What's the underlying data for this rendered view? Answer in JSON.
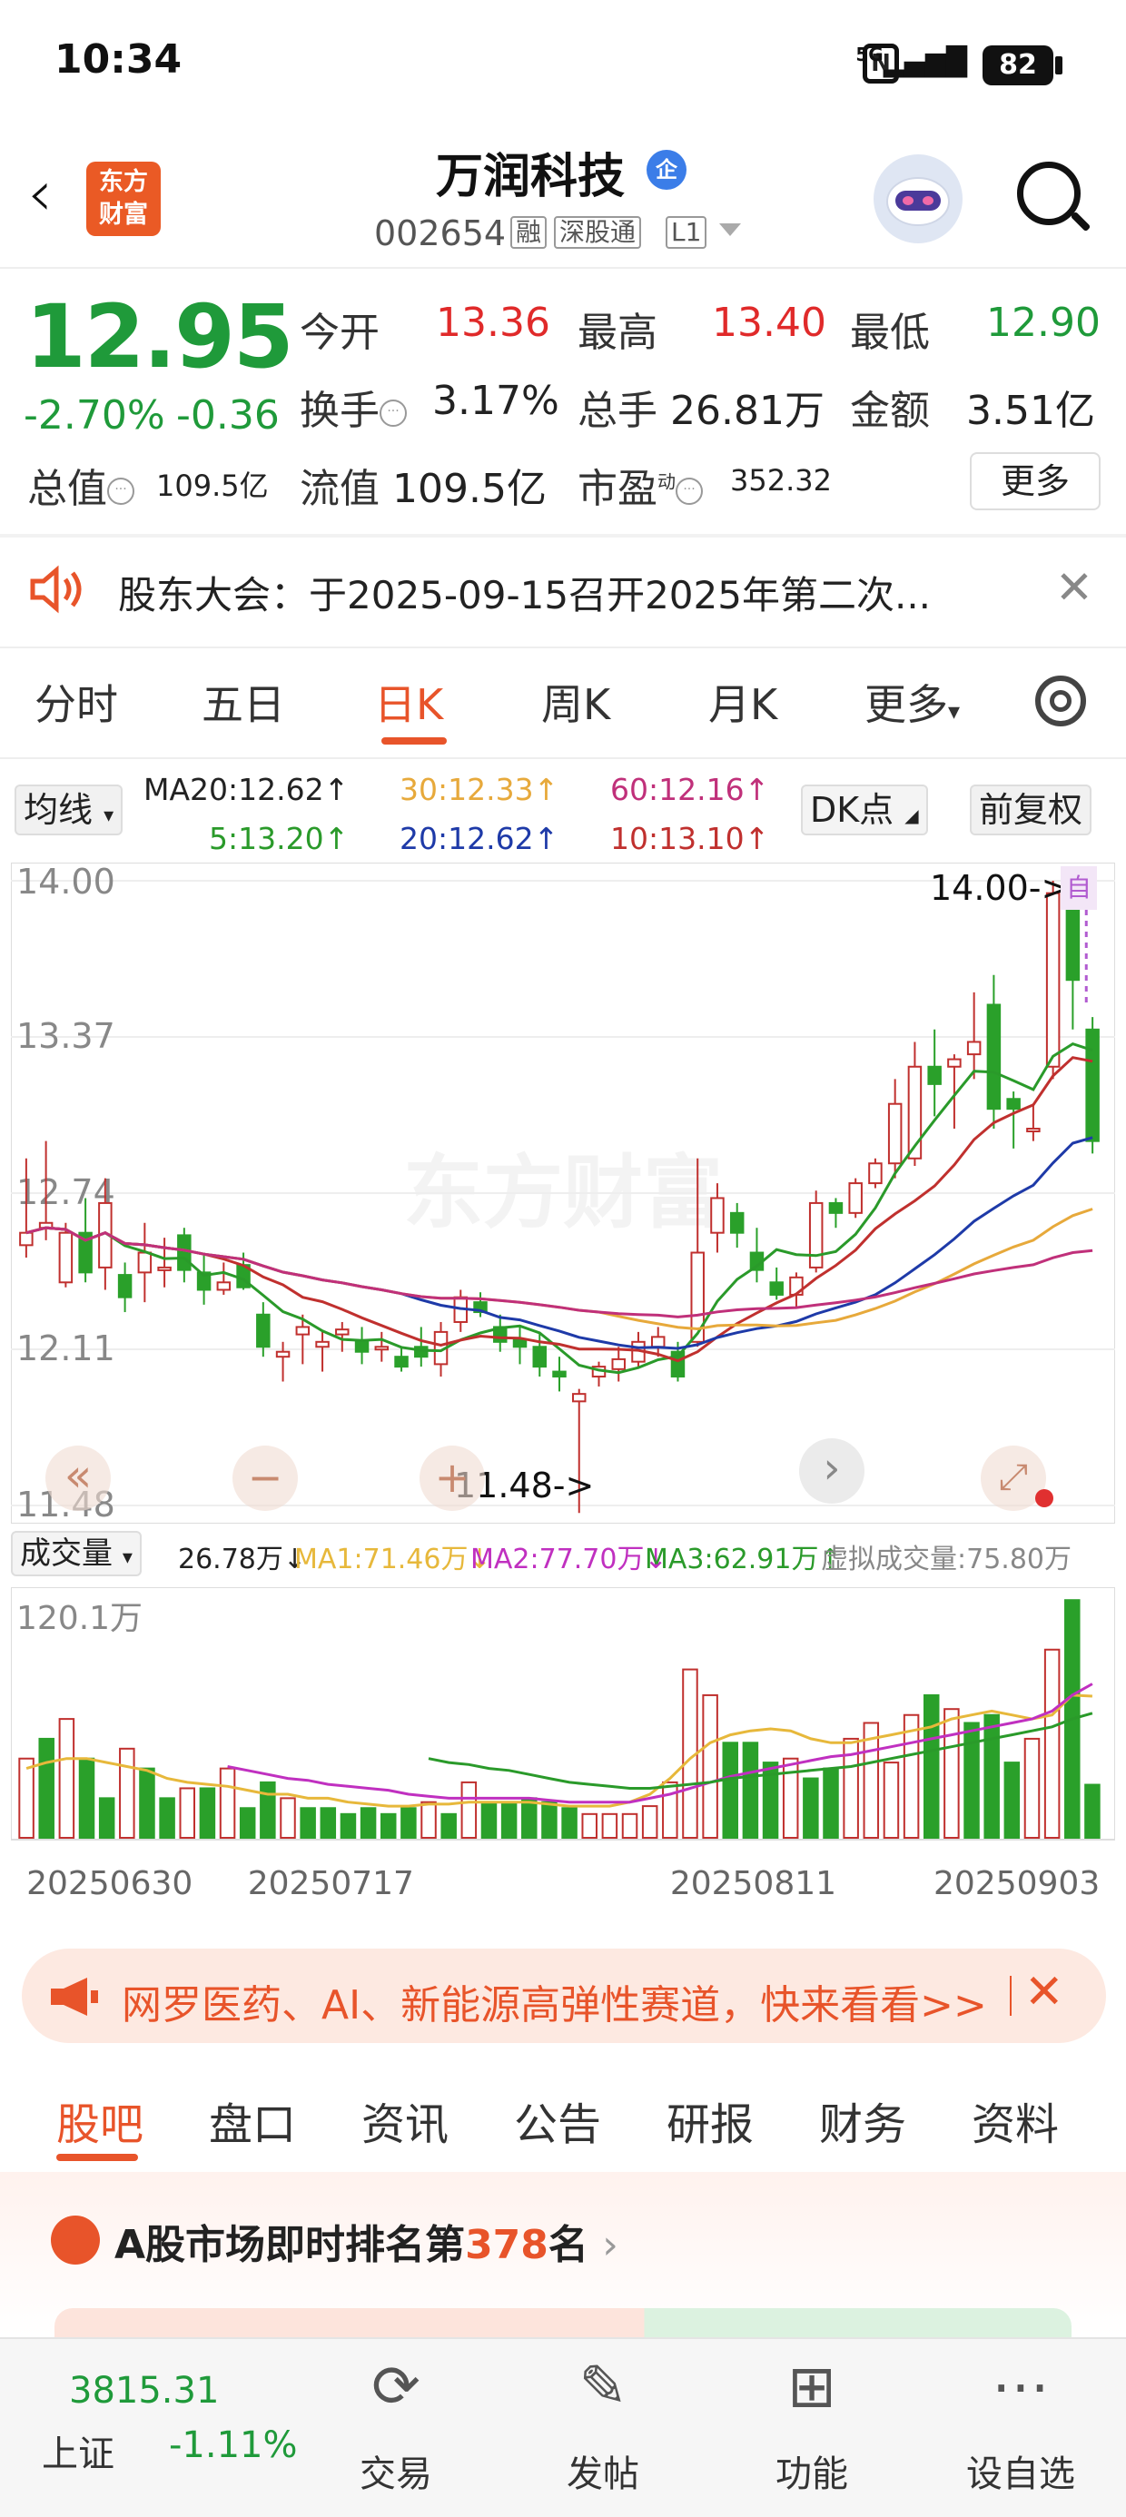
{
  "status_bar": {
    "time": "10:34",
    "network": "5G",
    "battery": "82"
  },
  "header": {
    "stock_name": "万润科技",
    "qi_badge": "企",
    "code": "002654",
    "tags": [
      "融",
      "深股通",
      "L1"
    ],
    "logo_line1": "东方",
    "logo_line2": "财富"
  },
  "quote": {
    "price": "12.95",
    "change_pct": "-2.70%",
    "change_amt": "-0.36",
    "open_label": "今开",
    "open": "13.36",
    "high_label": "最高",
    "high": "13.40",
    "low_label": "最低",
    "low": "12.90",
    "turnover_label": "换手",
    "turnover": "3.17%",
    "volume_label": "总手",
    "volume": "26.81万",
    "amount_label": "金额",
    "amount": "3.51亿",
    "total_cap_label": "总值",
    "total_cap": "109.5亿",
    "float_cap_label": "流值",
    "float_cap": "109.5亿",
    "pe_label": "市盈",
    "pe_sup": "动",
    "pe": "352.32",
    "more_button": "更多"
  },
  "notice": {
    "text": "股东大会：于2025-09-15召开2025年第二次..."
  },
  "k_tabs": {
    "items": [
      "分时",
      "五日",
      "日K",
      "周K",
      "月K",
      "更多"
    ],
    "active_index": 2
  },
  "ma_bar": {
    "selector": "均线",
    "ma20_head": "MA20:12.62↑",
    "ma30": "30:12.33↑",
    "ma60": "60:12.16↑",
    "ma5": "5:13.20↑",
    "ma20": "20:12.62↑",
    "ma10": "10:13.10↑",
    "dk_button": "DK点",
    "adjust_button": "前复权",
    "colors": {
      "ma5": "#2a9a2a",
      "ma10": "#c0302e",
      "ma20": "#1e3aa8",
      "ma30": "#e7a93b",
      "ma60": "#c0307a"
    }
  },
  "chart_data": [
    {
      "type": "candlestick",
      "y_axis_labels": [
        "14.00",
        "13.37",
        "12.74",
        "12.11",
        "11.48"
      ],
      "ylim": [
        11.48,
        14.0
      ],
      "annotation_high": "14.00->",
      "annotation_low": "11.48->",
      "self_tag": "自",
      "x_labels": [
        "20250630",
        "20250717",
        "20250811",
        "20250903"
      ],
      "candles": [
        {
          "o": 12.53,
          "h": 12.88,
          "l": 12.48,
          "c": 12.58
        },
        {
          "o": 12.6,
          "h": 12.95,
          "l": 12.55,
          "c": 12.62
        },
        {
          "o": 12.38,
          "h": 12.62,
          "l": 12.36,
          "c": 12.58
        },
        {
          "o": 12.58,
          "h": 12.72,
          "l": 12.38,
          "c": 12.42
        },
        {
          "o": 12.44,
          "h": 12.8,
          "l": 12.35,
          "c": 12.7
        },
        {
          "o": 12.41,
          "h": 12.46,
          "l": 12.26,
          "c": 12.32
        },
        {
          "o": 12.42,
          "h": 12.62,
          "l": 12.3,
          "c": 12.5
        },
        {
          "o": 12.43,
          "h": 12.56,
          "l": 12.36,
          "c": 12.44
        },
        {
          "o": 12.57,
          "h": 12.6,
          "l": 12.38,
          "c": 12.43
        },
        {
          "o": 12.42,
          "h": 12.5,
          "l": 12.29,
          "c": 12.35
        },
        {
          "o": 12.35,
          "h": 12.46,
          "l": 12.33,
          "c": 12.38
        },
        {
          "o": 12.45,
          "h": 12.5,
          "l": 12.35,
          "c": 12.36
        },
        {
          "o": 12.25,
          "h": 12.3,
          "l": 12.08,
          "c": 12.12
        },
        {
          "o": 12.08,
          "h": 12.14,
          "l": 11.98,
          "c": 12.1
        },
        {
          "o": 12.17,
          "h": 12.25,
          "l": 12.05,
          "c": 12.2
        },
        {
          "o": 12.12,
          "h": 12.18,
          "l": 12.02,
          "c": 12.14
        },
        {
          "o": 12.17,
          "h": 12.22,
          "l": 12.1,
          "c": 12.19
        },
        {
          "o": 12.14,
          "h": 12.2,
          "l": 12.05,
          "c": 12.1
        },
        {
          "o": 12.12,
          "h": 12.18,
          "l": 12.06,
          "c": 12.12
        },
        {
          "o": 12.08,
          "h": 12.12,
          "l": 12.02,
          "c": 12.04
        },
        {
          "o": 12.12,
          "h": 12.2,
          "l": 12.04,
          "c": 12.08
        },
        {
          "o": 12.05,
          "h": 12.22,
          "l": 12.0,
          "c": 12.18
        },
        {
          "o": 12.22,
          "h": 12.35,
          "l": 12.18,
          "c": 12.32
        },
        {
          "o": 12.3,
          "h": 12.34,
          "l": 12.24,
          "c": 12.26
        },
        {
          "o": 12.2,
          "h": 12.25,
          "l": 12.1,
          "c": 12.14
        },
        {
          "o": 12.15,
          "h": 12.2,
          "l": 12.05,
          "c": 12.12
        },
        {
          "o": 12.12,
          "h": 12.18,
          "l": 12.0,
          "c": 12.04
        },
        {
          "o": 12.02,
          "h": 12.08,
          "l": 11.94,
          "c": 12.0
        },
        {
          "o": 11.9,
          "h": 11.95,
          "l": 11.45,
          "c": 11.93
        },
        {
          "o": 12.0,
          "h": 12.06,
          "l": 11.96,
          "c": 12.04
        },
        {
          "o": 12.03,
          "h": 12.12,
          "l": 11.98,
          "c": 12.07
        },
        {
          "o": 12.06,
          "h": 12.18,
          "l": 12.04,
          "c": 12.14
        },
        {
          "o": 12.12,
          "h": 12.2,
          "l": 12.08,
          "c": 12.16
        },
        {
          "o": 12.1,
          "h": 12.14,
          "l": 11.98,
          "c": 12.0
        },
        {
          "o": 12.14,
          "h": 12.88,
          "l": 12.12,
          "c": 12.5
        },
        {
          "o": 12.58,
          "h": 12.78,
          "l": 12.5,
          "c": 12.72
        },
        {
          "o": 12.66,
          "h": 12.7,
          "l": 12.52,
          "c": 12.58
        },
        {
          "o": 12.5,
          "h": 12.6,
          "l": 12.38,
          "c": 12.43
        },
        {
          "o": 12.38,
          "h": 12.44,
          "l": 12.31,
          "c": 12.33
        },
        {
          "o": 12.33,
          "h": 12.42,
          "l": 12.28,
          "c": 12.4
        },
        {
          "o": 12.44,
          "h": 12.75,
          "l": 12.42,
          "c": 12.7
        },
        {
          "o": 12.7,
          "h": 12.72,
          "l": 12.6,
          "c": 12.66
        },
        {
          "o": 12.66,
          "h": 12.8,
          "l": 12.64,
          "c": 12.78
        },
        {
          "o": 12.78,
          "h": 12.88,
          "l": 12.76,
          "c": 12.86
        },
        {
          "o": 12.86,
          "h": 13.2,
          "l": 12.8,
          "c": 13.1
        },
        {
          "o": 12.88,
          "h": 13.35,
          "l": 12.85,
          "c": 13.25
        },
        {
          "o": 13.25,
          "h": 13.4,
          "l": 13.05,
          "c": 13.18
        },
        {
          "o": 13.25,
          "h": 13.3,
          "l": 13.0,
          "c": 13.28
        },
        {
          "o": 13.3,
          "h": 13.55,
          "l": 13.2,
          "c": 13.35
        },
        {
          "o": 13.5,
          "h": 13.62,
          "l": 13.0,
          "c": 13.08
        },
        {
          "o": 13.12,
          "h": 13.15,
          "l": 12.92,
          "c": 13.08
        },
        {
          "o": 13.0,
          "h": 13.1,
          "l": 12.95,
          "c": 13.0
        },
        {
          "o": 13.25,
          "h": 14.0,
          "l": 13.2,
          "c": 13.95
        },
        {
          "o": 13.9,
          "h": 14.0,
          "l": 13.4,
          "c": 13.6
        },
        {
          "o": 13.4,
          "h": 13.45,
          "l": 12.9,
          "c": 12.95
        }
      ]
    },
    {
      "type": "bar",
      "selector": "成交量",
      "current": "26.78万↓",
      "ma1": "MA1:71.46万↓",
      "ma2": "MA2:77.70万↓",
      "ma3": "MA3:62.91万↑",
      "virtual": "虚拟成交量:75.80万",
      "y_axis_label": "120.1万",
      "ylim": [
        0,
        120.1
      ],
      "unit": "万",
      "values": [
        40,
        50,
        60,
        40,
        20,
        45,
        35,
        20,
        25,
        25,
        35,
        15,
        28,
        20,
        15,
        15,
        12,
        15,
        12,
        15,
        18,
        12,
        28,
        18,
        18,
        20,
        18,
        15,
        12,
        12,
        12,
        16,
        28,
        85,
        72,
        48,
        48,
        38,
        40,
        30,
        35,
        50,
        58,
        38,
        62,
        72,
        65,
        58,
        62,
        38,
        50,
        95,
        120,
        26.8
      ],
      "up": [
        true,
        false,
        true,
        false,
        false,
        true,
        false,
        false,
        true,
        false,
        true,
        false,
        false,
        true,
        false,
        false,
        false,
        false,
        false,
        false,
        true,
        false,
        true,
        false,
        false,
        false,
        false,
        false,
        true,
        true,
        true,
        true,
        true,
        true,
        true,
        false,
        false,
        false,
        true,
        false,
        false,
        true,
        true,
        true,
        true,
        false,
        true,
        false,
        false,
        false,
        true,
        true,
        false,
        false
      ],
      "ma1_values": [
        35,
        38,
        40,
        40,
        38,
        36,
        34,
        30,
        28,
        27,
        26,
        24,
        22,
        22,
        20,
        20,
        18,
        17,
        16,
        16,
        17,
        17,
        18,
        18,
        18,
        18,
        17,
        16,
        16,
        16,
        18,
        22,
        30,
        40,
        48,
        52,
        54,
        55,
        54,
        50,
        48,
        48,
        50,
        52,
        54,
        56,
        60,
        62,
        64,
        62,
        60,
        62,
        72,
        71.5
      ],
      "ma2_values": [
        null,
        null,
        null,
        null,
        null,
        null,
        null,
        null,
        null,
        null,
        36,
        34,
        32,
        30,
        29,
        27,
        26,
        25,
        24,
        22,
        21,
        20,
        20,
        20,
        20,
        20,
        19,
        18,
        18,
        18,
        18,
        20,
        22,
        25,
        28,
        31,
        33,
        35,
        37,
        39,
        41,
        42,
        44,
        46,
        48,
        50,
        52,
        54,
        56,
        58,
        60,
        64,
        72,
        77.7
      ],
      "ma3_values": [
        null,
        null,
        null,
        null,
        null,
        null,
        null,
        null,
        null,
        null,
        null,
        null,
        null,
        null,
        null,
        null,
        null,
        null,
        null,
        null,
        40,
        38,
        37,
        35,
        34,
        32,
        30,
        28,
        27,
        26,
        25,
        25,
        26,
        27,
        28,
        30,
        31,
        32,
        33,
        34,
        35,
        36,
        38,
        40,
        42,
        44,
        46,
        48,
        50,
        52,
        54,
        56,
        60,
        62.9
      ]
    }
  ],
  "controls": {
    "left_arrow": "«",
    "right_arrow": "›"
  },
  "ad": {
    "text": "网罗医药、AI、新能源高弹性赛道，快来看看>>"
  },
  "bottom_tabs": {
    "items": [
      "股吧",
      "盘口",
      "资讯",
      "公告",
      "研报",
      "财务",
      "资料"
    ],
    "active_index": 0
  },
  "ranking": {
    "prefix": "A股市场即时排名第",
    "rank": "378",
    "suffix": "名"
  },
  "bottom_nav": {
    "index_value": "3815.31",
    "index_name": "上证",
    "index_change": "-1.11%",
    "items": [
      {
        "label": "交易",
        "icon": "trade-icon"
      },
      {
        "label": "发帖",
        "icon": "post-icon"
      },
      {
        "label": "功能",
        "icon": "grid-icon"
      },
      {
        "label": "设自选",
        "icon": "more-dots-icon"
      }
    ]
  }
}
